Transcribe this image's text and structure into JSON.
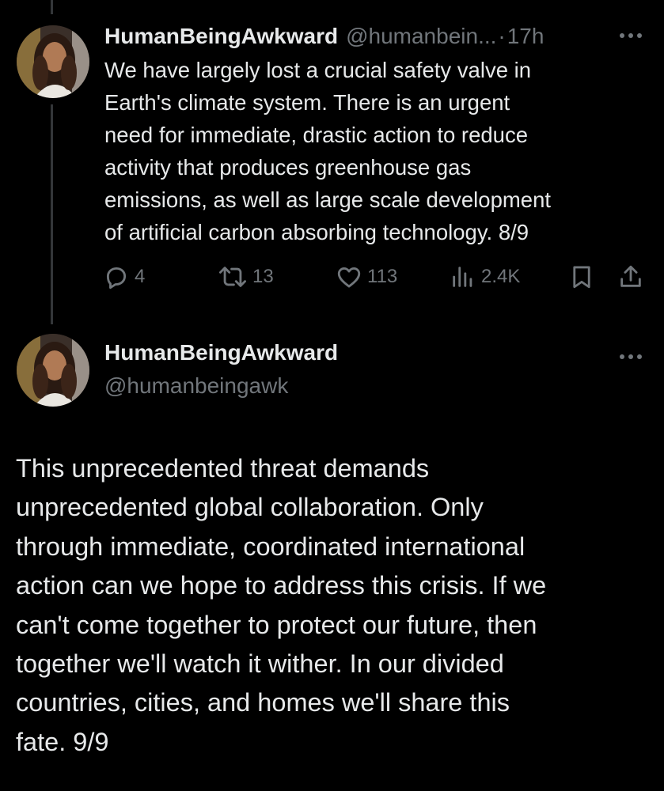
{
  "tweets": [
    {
      "author": {
        "display_name": "HumanBeingAwkward",
        "handle": "@humanbein...",
        "avatar_icon": "profile-photo"
      },
      "separator": "·",
      "time": "17h",
      "body_lines": [
        "We have largely lost a crucial safety valve in",
        "Earth's climate system. There is an urgent",
        "need for immediate, drastic action to reduce",
        "activity that produces greenhouse gas",
        "emissions, as well as large scale development",
        "of artificial carbon absorbing technology. 8/9"
      ],
      "actions": {
        "replies": "4",
        "reposts": "13",
        "likes": "113",
        "views": "2.4K"
      }
    },
    {
      "author": {
        "display_name": "HumanBeingAwkward",
        "handle": "@humanbeingawk",
        "avatar_icon": "profile-photo"
      },
      "body_lines": [
        "This unprecedented threat demands",
        "unprecedented global collaboration. Only",
        "through immediate, coordinated international",
        "action can we hope to address this crisis. If we",
        "can't come together to protect our future, then",
        "together we'll watch it wither. In our divided",
        "countries, cities, and homes we'll share this",
        "fate. 9/9"
      ]
    }
  ],
  "colors": {
    "background": "#000000",
    "primary_text": "#e7e9ea",
    "secondary_text": "#71767b",
    "thread_line": "#333639"
  },
  "icons": [
    "reply-icon",
    "repost-icon",
    "like-icon",
    "views-icon",
    "bookmark-icon",
    "share-icon",
    "more-icon"
  ]
}
